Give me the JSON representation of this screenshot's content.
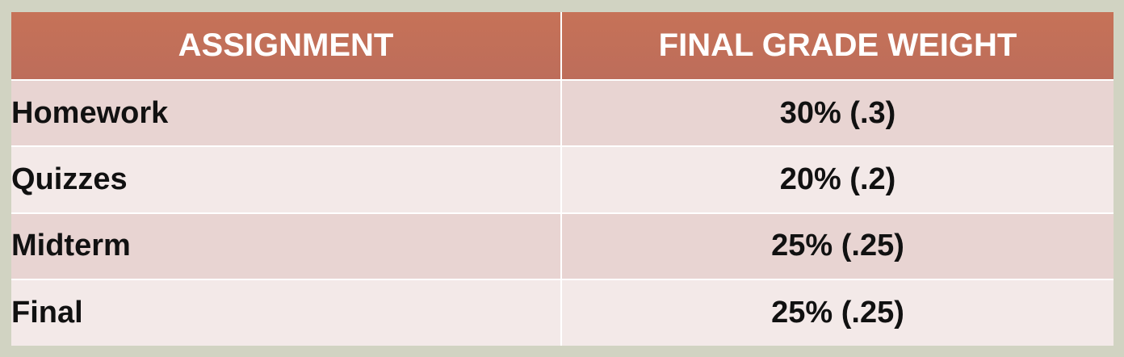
{
  "table": {
    "headers": [
      "ASSIGNMENT",
      "FINAL GRADE WEIGHT"
    ],
    "rows": [
      {
        "assignment": "Homework",
        "weight": "30% (.3)"
      },
      {
        "assignment": "Quizzes",
        "weight": "20% (.2)"
      },
      {
        "assignment": "Midterm",
        "weight": "25% (.25)"
      },
      {
        "assignment": "Final",
        "weight": "25% (.25)"
      }
    ]
  },
  "colors": {
    "background": "#d1d3c2",
    "header": "#c06f59",
    "header_text": "#ffffff",
    "row_odd": "#e8d4d2",
    "row_even": "#f3e9e8",
    "cell_text": "#111111"
  }
}
